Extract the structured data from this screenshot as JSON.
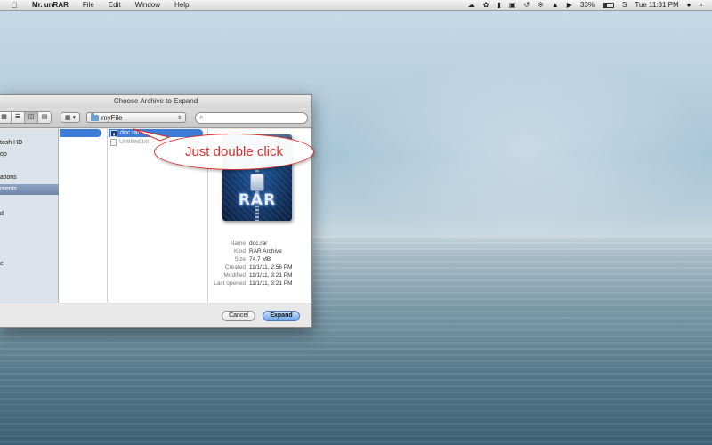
{
  "menubar": {
    "apple_icon": "apple-logo-icon",
    "app_name": "Mr. unRAR",
    "items": [
      {
        "label": "File"
      },
      {
        "label": "Edit"
      },
      {
        "label": "Window"
      },
      {
        "label": "Help"
      }
    ],
    "status": {
      "battery_percent": "33%",
      "clock": "Tue 11:31 PM",
      "icons": [
        "cloud-icon",
        "leaf-icon",
        "disk-icon",
        "lock-icon",
        "time-machine-icon",
        "bluetooth-icon",
        "wifi-icon",
        "volume-icon",
        "battery-icon",
        "skype-icon",
        "user-icon",
        "spotlight-icon"
      ]
    }
  },
  "dialog": {
    "title": "Choose Archive to Expand",
    "path_label": "myFile",
    "search_placeholder": "",
    "sidebar": {
      "items": [
        {
          "label": "tosh HD"
        },
        {
          "label": "op"
        },
        {
          "label": "ations"
        },
        {
          "label": "ments",
          "selected": true
        },
        {
          "label": "d"
        },
        {
          "label": "e"
        }
      ]
    },
    "files": [
      {
        "name": "doc.rar",
        "selected": true
      },
      {
        "name": "Untitled.txt",
        "selected": false
      }
    ],
    "preview": {
      "icon_label": "RAR",
      "info": [
        {
          "key": "Name",
          "value": "doc.rar"
        },
        {
          "key": "Kind",
          "value": "RAR Archive"
        },
        {
          "key": "Size",
          "value": "74.7 MB"
        },
        {
          "key": "Created",
          "value": "11/1/11, 2:56 PM"
        },
        {
          "key": "Modified",
          "value": "11/1/11, 3:21 PM"
        },
        {
          "key": "Last opened",
          "value": "11/1/11, 3:21 PM"
        }
      ]
    },
    "buttons": {
      "cancel": "Cancel",
      "expand": "Expand"
    }
  },
  "callout": {
    "text": "Just double click",
    "color": "#d9302a"
  }
}
